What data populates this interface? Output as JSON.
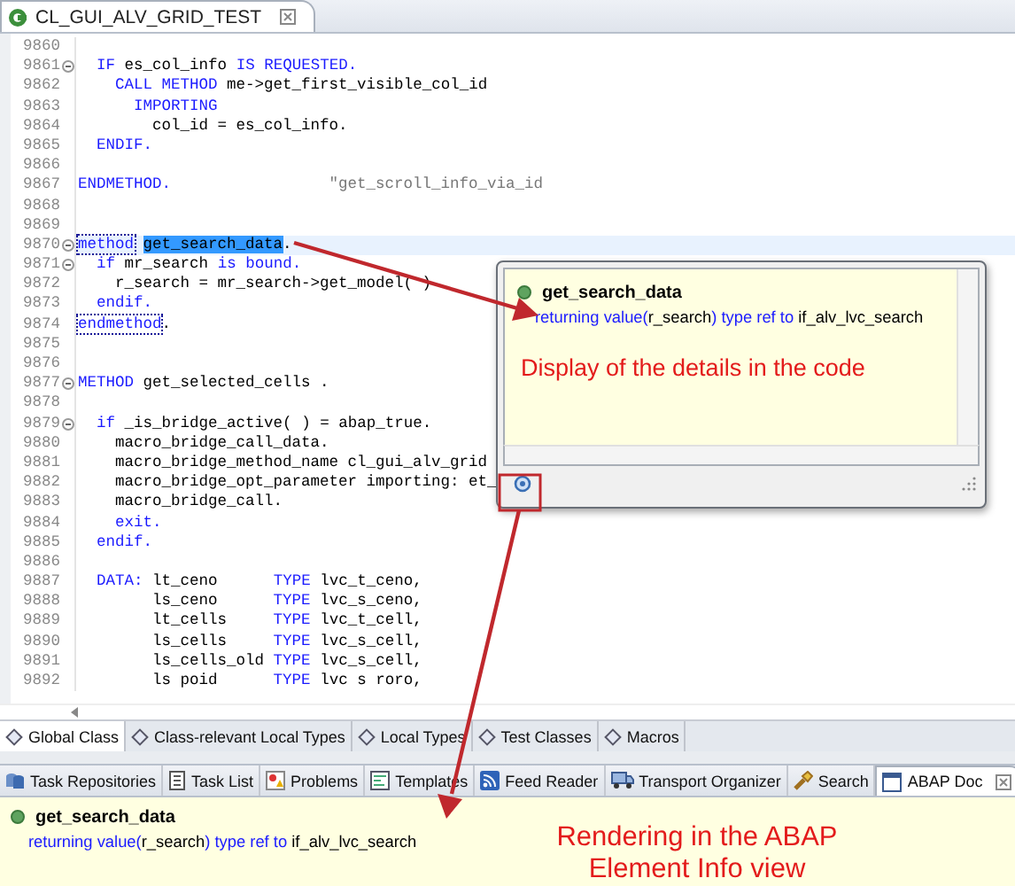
{
  "editor": {
    "tab": {
      "title": "CL_GUI_ALV_GRID_TEST"
    },
    "lines": [
      {
        "number": "9860",
        "fold": false,
        "current": false
      },
      {
        "number": "9861",
        "fold": true,
        "current": false,
        "segments": [
          {
            "kind": "kw",
            "text": "  IF"
          },
          {
            "kind": "plain",
            "text": " es_col_info "
          },
          {
            "kind": "kw",
            "text": "IS REQUESTED."
          }
        ]
      },
      {
        "number": "9862",
        "fold": false,
        "current": false,
        "segments": [
          {
            "kind": "kw",
            "text": "    CALL METHOD"
          },
          {
            "kind": "plain",
            "text": " me->get_first_visible_col_id"
          }
        ]
      },
      {
        "number": "9863",
        "fold": false,
        "current": false,
        "segments": [
          {
            "kind": "kw",
            "text": "      IMPORTING"
          }
        ]
      },
      {
        "number": "9864",
        "fold": false,
        "current": false,
        "segments": [
          {
            "kind": "plain",
            "text": "        col_id = es_col_info."
          }
        ]
      },
      {
        "number": "9865",
        "fold": false,
        "current": false,
        "segments": [
          {
            "kind": "kw",
            "text": "  ENDIF."
          }
        ]
      },
      {
        "number": "9866",
        "fold": false,
        "current": false
      },
      {
        "number": "9867",
        "fold": false,
        "current": false,
        "segments": [
          {
            "kind": "kw",
            "text": "ENDMETHOD."
          },
          {
            "kind": "comment",
            "text": "                 \"get_scroll_info_via_id"
          }
        ]
      },
      {
        "number": "9868",
        "fold": false,
        "current": false
      },
      {
        "number": "9869",
        "fold": false,
        "current": false
      },
      {
        "number": "9870",
        "fold": true,
        "current": true,
        "segments": [
          {
            "kind": "boxed",
            "text": "method"
          },
          {
            "kind": "selected",
            "text": " get_search_data"
          },
          {
            "kind": "plain",
            "text": "."
          }
        ]
      },
      {
        "number": "9871",
        "fold": true,
        "current": false,
        "segments": [
          {
            "kind": "kw",
            "text": "  if"
          },
          {
            "kind": "plain",
            "text": " mr_search "
          },
          {
            "kind": "kw",
            "text": "is bound."
          }
        ]
      },
      {
        "number": "9872",
        "fold": false,
        "current": false,
        "segments": [
          {
            "kind": "plain",
            "text": "    r_search = mr_search->get_model( )"
          }
        ]
      },
      {
        "number": "9873",
        "fold": false,
        "current": false,
        "segments": [
          {
            "kind": "kw",
            "text": "  endif."
          }
        ]
      },
      {
        "number": "9874",
        "fold": false,
        "current": false,
        "segments": [
          {
            "kind": "boxed",
            "text": "endmethod"
          },
          {
            "kind": "plain",
            "text": "."
          }
        ]
      },
      {
        "number": "9875",
        "fold": false,
        "current": false
      },
      {
        "number": "9876",
        "fold": false,
        "current": false
      },
      {
        "number": "9877",
        "fold": true,
        "current": false,
        "segments": [
          {
            "kind": "kw",
            "text": "METHOD"
          },
          {
            "kind": "plain",
            "text": " get_selected_cells ."
          }
        ]
      },
      {
        "number": "9878",
        "fold": false,
        "current": false
      },
      {
        "number": "9879",
        "fold": true,
        "current": false,
        "segments": [
          {
            "kind": "kw",
            "text": "  if"
          },
          {
            "kind": "plain",
            "text": " _is_bridge_active( ) = abap_true."
          }
        ]
      },
      {
        "number": "9880",
        "fold": false,
        "current": false,
        "segments": [
          {
            "kind": "plain",
            "text": "    macro_bridge_call_data."
          }
        ]
      },
      {
        "number": "9881",
        "fold": false,
        "current": false,
        "segments": [
          {
            "kind": "plain",
            "text": "    macro_bridge_method_name cl_gui_alv_grid"
          }
        ]
      },
      {
        "number": "9882",
        "fold": false,
        "current": false,
        "segments": [
          {
            "kind": "plain",
            "text": "    macro_bridge_opt_parameter importing: et_"
          }
        ]
      },
      {
        "number": "9883",
        "fold": false,
        "current": false,
        "segments": [
          {
            "kind": "plain",
            "text": "    macro_bridge_call."
          }
        ]
      },
      {
        "number": "9884",
        "fold": false,
        "current": false,
        "segments": [
          {
            "kind": "kw",
            "text": "    exit."
          }
        ]
      },
      {
        "number": "9885",
        "fold": false,
        "current": false,
        "segments": [
          {
            "kind": "kw",
            "text": "  endif."
          }
        ]
      },
      {
        "number": "9886",
        "fold": false,
        "current": false
      },
      {
        "number": "9887",
        "fold": false,
        "current": false,
        "segments": [
          {
            "kind": "kw",
            "text": "  DATA:"
          },
          {
            "kind": "plain",
            "text": " lt_ceno      "
          },
          {
            "kind": "kw",
            "text": "TYPE"
          },
          {
            "kind": "plain",
            "text": " lvc_t_ceno,"
          }
        ]
      },
      {
        "number": "9888",
        "fold": false,
        "current": false,
        "segments": [
          {
            "kind": "plain",
            "text": "        ls_ceno      "
          },
          {
            "kind": "kw",
            "text": "TYPE"
          },
          {
            "kind": "plain",
            "text": " lvc_s_ceno,"
          }
        ]
      },
      {
        "number": "9889",
        "fold": false,
        "current": false,
        "segments": [
          {
            "kind": "plain",
            "text": "        lt_cells     "
          },
          {
            "kind": "kw",
            "text": "TYPE"
          },
          {
            "kind": "plain",
            "text": " lvc_t_cell,"
          }
        ]
      },
      {
        "number": "9890",
        "fold": false,
        "current": false,
        "segments": [
          {
            "kind": "plain",
            "text": "        ls_cells     "
          },
          {
            "kind": "kw",
            "text": "TYPE"
          },
          {
            "kind": "plain",
            "text": " lvc_s_cell,"
          }
        ]
      },
      {
        "number": "9891",
        "fold": false,
        "current": false,
        "segments": [
          {
            "kind": "plain",
            "text": "        ls_cells_old "
          },
          {
            "kind": "kw",
            "text": "TYPE"
          },
          {
            "kind": "plain",
            "text": " lvc_s_cell,"
          }
        ]
      },
      {
        "number": "9892",
        "fold": false,
        "current": false,
        "segments": [
          {
            "kind": "plain",
            "text": "        ls poid      "
          },
          {
            "kind": "kw",
            "text": "TYPE"
          },
          {
            "kind": "plain",
            "text": " lvc s roro,"
          }
        ]
      }
    ]
  },
  "popup": {
    "name": "get_search_data",
    "signature": [
      {
        "kind": "kw",
        "text": "returning "
      },
      {
        "kind": "kw",
        "text": "value("
      },
      {
        "kind": "plain",
        "text": "r_search"
      },
      {
        "kind": "kw",
        "text": ") type ref to "
      },
      {
        "kind": "plain",
        "text": "if_alv_lvc_search"
      }
    ],
    "annotation": "Display of the details in the code"
  },
  "editor_tabs": [
    {
      "label": "Global Class",
      "selected": true
    },
    {
      "label": "Class-relevant Local Types",
      "selected": false
    },
    {
      "label": "Local Types",
      "selected": false
    },
    {
      "label": "Test Classes",
      "selected": false
    },
    {
      "label": "Macros",
      "selected": false
    }
  ],
  "view_tabs": [
    {
      "label": "Task Repositories",
      "selected": false
    },
    {
      "label": "Task List",
      "selected": false
    },
    {
      "label": "Problems",
      "selected": false
    },
    {
      "label": "Templates",
      "selected": false
    },
    {
      "label": "Feed Reader",
      "selected": false
    },
    {
      "label": "Transport Organizer",
      "selected": false
    },
    {
      "label": "Search",
      "selected": false
    },
    {
      "label": "ABAP Doc",
      "selected": true
    }
  ],
  "element_info": {
    "name": "get_search_data",
    "signature": [
      {
        "kind": "kw",
        "text": "returning "
      },
      {
        "kind": "kw",
        "text": "value("
      },
      {
        "kind": "plain",
        "text": "r_search"
      },
      {
        "kind": "kw",
        "text": ") type ref to "
      },
      {
        "kind": "plain",
        "text": "if_alv_lvc_search"
      }
    ],
    "annotation": "Rendering in the ABAP Element Info view"
  }
}
